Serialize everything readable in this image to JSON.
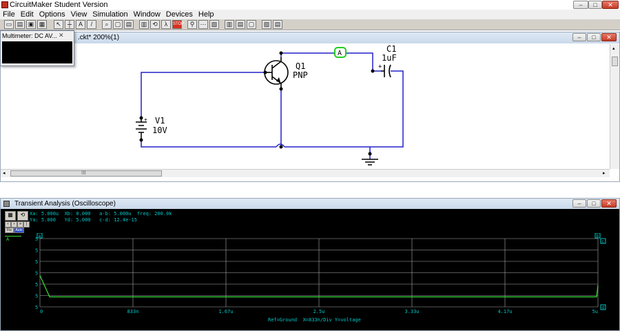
{
  "app": {
    "title": "CircuitMaker Student Version",
    "menu": [
      "File",
      "Edit",
      "Options",
      "View",
      "Simulation",
      "Window",
      "Devices",
      "Help"
    ]
  },
  "icons": {
    "window_minimize": "minimize-icon",
    "window_maximize": "maximize-icon",
    "window_close": "close-icon"
  },
  "window_controls": {
    "minimize": "–",
    "maximize": "□",
    "close": "✕"
  },
  "toolbar_glyphs": {
    "new": "▭",
    "open": "▤",
    "save": "▣",
    "print": "▦",
    "arrow": "↖",
    "wire": "┼",
    "text": "A",
    "probe": "/",
    "zoom": "⌕",
    "fit": "▢",
    "parts": "▤",
    "digital": "▥",
    "rotate": "⟲",
    "stepper": "λ",
    "stop": "STOP",
    "run": "⚲",
    "trace": "⋯",
    "scope": "▧",
    "s1": "▥",
    "s2": "▤",
    "s3": "▢",
    "s4": "▨",
    "s5": "▤"
  },
  "colors": {
    "wire": "#2020c8",
    "trace": "#38e038",
    "scope_text": "#00c8c8",
    "grid": "#b0b0b0",
    "probe_box": "#22cc22"
  },
  "circuit": {
    "title_suffix": ".ckt* 200%(1)",
    "hscroll_label": "III",
    "probe_label": "A",
    "battery": {
      "ref": "V1",
      "value": "10V",
      "plus": "+"
    },
    "transistor": {
      "ref": "Q1",
      "type": "PNP"
    },
    "capacitor": {
      "ref": "C1",
      "value": "1uF",
      "plus": "+"
    }
  },
  "multimeter": {
    "title": "Multimeter: DC AV...",
    "close": "✕"
  },
  "scope": {
    "title": "Transient Analysis (Oscilloscope)",
    "row1": "Xa: 5.000u  Xb: 0.000   a-b: 5.000u  freq: 200.0k",
    "row2": "Ya: 5.000   Yd: 5.000   c-d: 12.4e-15",
    "legend": "A",
    "ylabels": [
      "5",
      "5",
      "5",
      "5",
      "5",
      "5",
      "5"
    ],
    "xlabels": [
      "0",
      "833n",
      "1.67u",
      "2.5u",
      "3.33u",
      "4.17u",
      "5u"
    ],
    "footer": "Ref=Ground  X=833n/Div Y=voltage",
    "marker_a": "a",
    "marker_b": "b",
    "marker_c": "c",
    "marker_d": "d",
    "btn_glyphs": {
      "b1": "▦",
      "b2": "⟲",
      "b3": "‹",
      "b4": "›",
      "b5": "»",
      "b6": "|"
    },
    "btn_labels": {
      "b7": "Fix",
      "b8": "Auto"
    }
  }
}
